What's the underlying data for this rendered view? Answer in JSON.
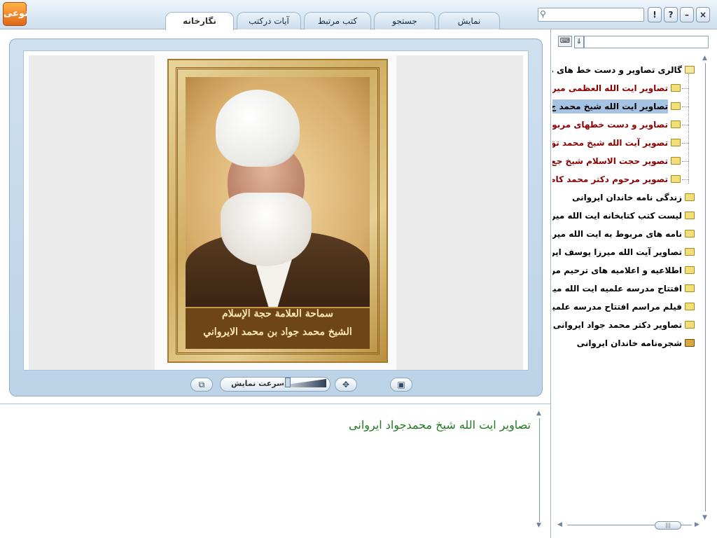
{
  "app": {
    "logo_text": "نوعی",
    "tabs": [
      {
        "label": "نگارخانه",
        "active": true
      },
      {
        "label": "آیات درکتب",
        "active": false
      },
      {
        "label": "کتب مرتبط",
        "active": false
      },
      {
        "label": "جستجو",
        "active": false
      },
      {
        "label": "نمایش",
        "active": false
      }
    ],
    "search_placeholder": "",
    "window_buttons": [
      "!",
      "?",
      "–",
      "×"
    ]
  },
  "viewer": {
    "caption_line1": "سماحة العلامة حجة الإسلام",
    "caption_line2": "الشيخ محمد جواد بن محمد الايرواني",
    "speed_label": "سرعت نمایش",
    "speed_level": 0.2
  },
  "description": {
    "text": "تصاویر ایت الله شیخ محمدجواد ایروانی",
    "text_color": "#1f7a1f"
  },
  "tree": {
    "filter_placeholder": "",
    "items": [
      {
        "label": "گالری تصاویر و دست خط های مرب",
        "level": 0,
        "icon": "open-folder-icon",
        "color": "#000000"
      },
      {
        "label": "تصاویر ایت الله العظمی میرز",
        "level": 1,
        "icon": "folder-icon",
        "color": "#8b0000"
      },
      {
        "label": "تصاویر ایت الله شیخ محمد ج",
        "level": 1,
        "icon": "folder-icon",
        "color": "#000000",
        "selected": true
      },
      {
        "label": "تصاویر و دست خطهای مربوط",
        "level": 1,
        "icon": "folder-icon",
        "color": "#8b0000"
      },
      {
        "label": "تصویر آیت الله شیخ محمد تق",
        "level": 1,
        "icon": "folder-icon",
        "color": "#8b0000"
      },
      {
        "label": "تصویر حجت الاسلام شیخ جع",
        "level": 1,
        "icon": "folder-icon",
        "color": "#8b0000"
      },
      {
        "label": "تصویر مرحوم دکتر محمد کاظ",
        "level": 1,
        "icon": "folder-icon",
        "color": "#8b0000"
      },
      {
        "label": "زندگی نامه خاندان ایروانی",
        "level": 0,
        "icon": "folder-icon",
        "color": "#000000"
      },
      {
        "label": "لیست کتب کتابخانه ایت الله میر",
        "level": 0,
        "icon": "folder-icon",
        "color": "#000000"
      },
      {
        "label": "نامه های مربوط به ایت الله میرزا",
        "level": 0,
        "icon": "folder-icon",
        "color": "#000000"
      },
      {
        "label": "تصاویر آیت الله میرزا یوسف ایر",
        "level": 0,
        "icon": "folder-icon",
        "color": "#000000"
      },
      {
        "label": "اطلاعیه و اعلامیه های ترحیم مرح",
        "level": 0,
        "icon": "folder-icon",
        "color": "#000000"
      },
      {
        "label": "افتتاح مدرسه علمیه ایت الله میر",
        "level": 0,
        "icon": "folder-icon",
        "color": "#000000"
      },
      {
        "label": "فیلم مراسم افتتاح مدرسه علمیه",
        "level": 0,
        "icon": "folder-icon",
        "color": "#000000"
      },
      {
        "label": "تصاویر دکتر محمد جواد ایروانی",
        "level": 0,
        "icon": "folder-icon",
        "color": "#000000"
      },
      {
        "label": "شجره‌نامه خاندان ایروانی",
        "level": 0,
        "icon": "camera-icon",
        "color": "#000000"
      }
    ]
  },
  "colors": {
    "accent": "#cfdfee",
    "selection": "#a7c3e3",
    "tree_red": "#8b0000"
  }
}
